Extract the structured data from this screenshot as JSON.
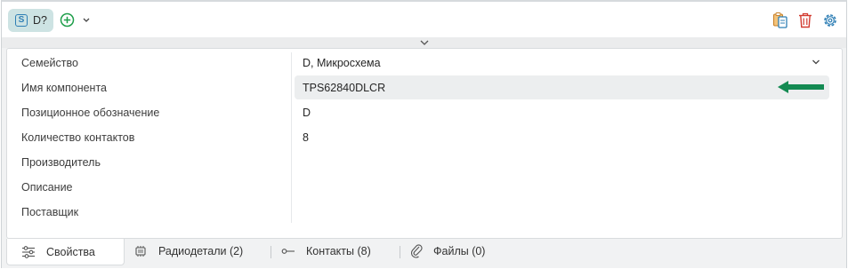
{
  "toolbar": {
    "chip_icon_letter": "S",
    "chip_label": "D?",
    "add_icon": "plus-circle-icon",
    "right_icons": [
      "clipboard-copy-icon",
      "trash-icon",
      "gear-icon"
    ],
    "accent": "#1e9e4a"
  },
  "properties": {
    "rows": [
      {
        "label": "Семейство",
        "value": "D, Микросхема"
      },
      {
        "label": "Имя компонента",
        "value": "TPS62840DLCR"
      },
      {
        "label": "Позиционное обозначение",
        "value": "D"
      },
      {
        "label": "Количество контактов",
        "value": "8"
      },
      {
        "label": "Производитель",
        "value": ""
      },
      {
        "label": "Описание",
        "value": ""
      },
      {
        "label": "Поставщик",
        "value": ""
      }
    ]
  },
  "tabs": [
    {
      "label": "Свойства",
      "icon": "sliders-icon"
    },
    {
      "label": "Радиодетали (2)",
      "icon": "chip-icon"
    },
    {
      "label": "Контакты (8)",
      "icon": "pin-icon"
    },
    {
      "label": "Файлы (0)",
      "icon": "paperclip-icon"
    }
  ],
  "highlight_arrow_color": "#138a52"
}
